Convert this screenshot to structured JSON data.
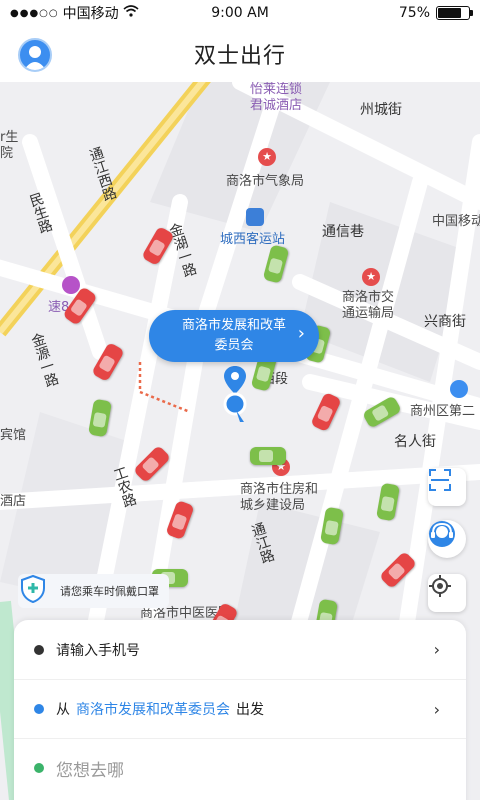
{
  "status": {
    "carrier": "中国移动",
    "time": "9:00 AM",
    "battery": "75%",
    "battery_level": 0.75
  },
  "header": {
    "title": "双士出行"
  },
  "map": {
    "pois": {
      "yilai": "怡莱连锁\n君诚酒店",
      "zhoucheng": "州城街",
      "qixiang": "商洛市气象局",
      "chengxi": "城西客运站",
      "tongxin": "通信巷",
      "mobile": "中国移动",
      "jiaotong": "商洛市交\n通运输局",
      "xingshang": "兴商街",
      "shangzhou": "商州区第二",
      "mingren": "名人街",
      "zhujian": "商洛市住房和\n城乡建设局",
      "hospital": "商洛市中医医院",
      "hotel_left": "宾馆",
      "hotel_left2": "酒店",
      "left_top": "r生\n院",
      "su8": "速8",
      "xisan": "西段",
      "tongjiang_rd": "通江西路",
      "minsheng_rd": "民生路",
      "jinhuan_rd": "金湖一路",
      "jinhuan2_rd": "金源一路",
      "tongjiang_side": "通江路",
      "gongnong_rd": "工农路"
    }
  },
  "bubble": {
    "text": "商洛市发展和改革委员会"
  },
  "mask_notice": {
    "text": "请您乘车时佩戴口罩"
  },
  "panel": {
    "phone_placeholder": "请输入手机号",
    "from_prefix": "从",
    "from_place": "商洛市发展和改革委员会",
    "from_suffix": "出发",
    "destination_placeholder": "您想去哪"
  },
  "colors": {
    "accent": "#2f86e6",
    "dot_dark": "#333333",
    "dot_blue": "#2f86e6",
    "dot_green": "#3bb36a"
  },
  "icons": [
    "user-avatar-icon",
    "wifi-icon",
    "battery-icon",
    "scan-icon",
    "customer-service-icon",
    "locate-icon",
    "shield-icon",
    "location-pin-icon",
    "car-icon"
  ]
}
